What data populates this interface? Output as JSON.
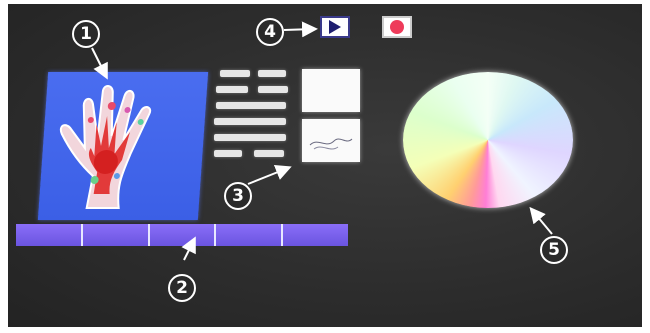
{
  "callouts": {
    "c1": "1",
    "c2": "2",
    "c3": "3",
    "c4": "4",
    "c5": "5"
  },
  "icons": {
    "play": "play-icon",
    "record": "record-icon"
  },
  "colors": {
    "background": "#2d2d2d",
    "hand_panel": "#3b5fe6",
    "strip": "#7a62ee",
    "play_icon": "#1e1e70",
    "record_icon": "#ee3b5a"
  }
}
